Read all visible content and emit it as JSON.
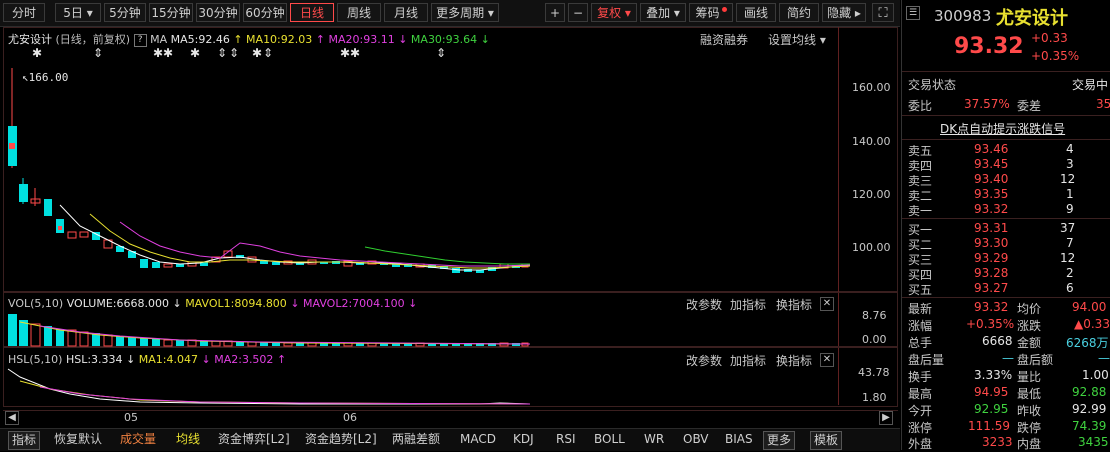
{
  "toolbar": {
    "periods": [
      "分时",
      "5日",
      "5分钟",
      "15分钟",
      "30分钟",
      "60分钟",
      "日线",
      "周线",
      "月线",
      "更多周期"
    ],
    "active_period": "日线",
    "right_buttons": [
      "+",
      "−",
      "复权",
      "叠加",
      "筹码",
      "画线",
      "简约",
      "隐藏"
    ]
  },
  "main_chart": {
    "title": "尤安设计",
    "mode": "(日线，前复权)",
    "ma_label": "MA",
    "ma5": "MA5:92.46",
    "ma10": "MA10:92.03",
    "ma20": "MA20:93.11",
    "ma30": "MA30:93.64",
    "right_links": [
      "融资融券",
      "设置均线"
    ],
    "high_marker": "166.00",
    "y_ticks": [
      "160.00",
      "140.00",
      "120.00",
      "100.00"
    ]
  },
  "vol_chart": {
    "label": "VOL(5,10)",
    "volume": "VOLUME:6668.000",
    "mavol1": "MAVOL1:8094.800",
    "mavol2": "MAVOL2:7004.100",
    "buttons": [
      "改参数",
      "加指标",
      "换指标"
    ],
    "y_ticks": [
      "8.76",
      "0.00"
    ]
  },
  "hsl_chart": {
    "label": "HSL(5,10)",
    "hsl": "HSL:3.334",
    "ma1": "MA1:4.047",
    "ma2": "MA2:3.502",
    "buttons": [
      "改参数",
      "加指标",
      "换指标"
    ],
    "y_ticks": [
      "43.78",
      "1.80"
    ]
  },
  "x_axis": [
    "05",
    "06"
  ],
  "bottom_tabs": [
    "指标",
    "恢复默认",
    "成交量",
    "均线",
    "资金博弈[L2]",
    "资金趋势[L2]",
    "两融差额",
    "MACD",
    "KDJ",
    "RSI",
    "BOLL",
    "WR",
    "OBV",
    "BIAS",
    "更多",
    "模板"
  ],
  "quote": {
    "code": "300983",
    "name": "尤安设计",
    "price": "93.32",
    "change": "+0.33",
    "change_pct": "+0.35%",
    "status_label": "交易状态",
    "status_value": "交易中",
    "weibi_label": "委比",
    "weibi_value": "37.57%",
    "weicha_label": "委差",
    "weicha_value": "35",
    "dk_link": "DK点自动提示涨跌信号",
    "sell": [
      {
        "label": "卖五",
        "price": "93.46",
        "vol": "4"
      },
      {
        "label": "卖四",
        "price": "93.45",
        "vol": "3"
      },
      {
        "label": "卖三",
        "price": "93.40",
        "vol": "12"
      },
      {
        "label": "卖二",
        "price": "93.35",
        "vol": "1"
      },
      {
        "label": "卖一",
        "price": "93.32",
        "vol": "9"
      }
    ],
    "buy": [
      {
        "label": "买一",
        "price": "93.31",
        "vol": "37"
      },
      {
        "label": "买二",
        "price": "93.30",
        "vol": "7"
      },
      {
        "label": "买三",
        "price": "93.29",
        "vol": "12"
      },
      {
        "label": "买四",
        "price": "93.28",
        "vol": "2"
      },
      {
        "label": "买五",
        "price": "93.27",
        "vol": "6"
      }
    ],
    "stats": [
      {
        "l1": "最新",
        "v1": "93.32",
        "l2": "均价",
        "v2": "94.00"
      },
      {
        "l1": "涨幅",
        "v1": "+0.35%",
        "l2": "涨跌",
        "v2": "▲0.33"
      },
      {
        "l1": "总手",
        "v1": "6668",
        "l2": "金额",
        "v2": "6268万"
      },
      {
        "l1": "盘后量",
        "v1": "—",
        "l2": "盘后额",
        "v2": "—"
      },
      {
        "l1": "换手",
        "v1": "3.33%",
        "l2": "量比",
        "v2": "1.00"
      },
      {
        "l1": "最高",
        "v1": "94.95",
        "l2": "最低",
        "v2": "92.88"
      },
      {
        "l1": "今开",
        "v1": "92.95",
        "l2": "昨收",
        "v2": "92.99"
      },
      {
        "l1": "涨停",
        "v1": "111.59",
        "l2": "跌停",
        "v2": "74.39"
      },
      {
        "l1": "外盘",
        "v1": "3233",
        "l2": "内盘",
        "v2": "3435"
      }
    ]
  },
  "colors": {
    "up": "#ff4a4a",
    "down": "#00e0e0",
    "ma5": "#ffffff",
    "ma10": "#e8e030",
    "ma20": "#e040e0",
    "ma30": "#30d030"
  }
}
